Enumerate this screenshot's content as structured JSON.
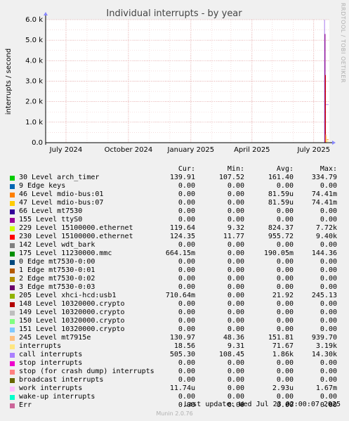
{
  "chart_data": {
    "type": "line",
    "title": "Individual interrupts - by year",
    "ylabel": "interrupts / second",
    "xlabel": "",
    "y_ticks": [
      "0.0",
      "1.0 k",
      "2.0 k",
      "3.0 k",
      "4.0 k",
      "5.0 k",
      "6.0 k"
    ],
    "ylim": [
      0,
      6000
    ],
    "x_ticks": [
      "July 2024",
      "October 2024",
      "January 2025",
      "April 2025",
      "July 2025"
    ],
    "xlim": [
      "2024-06-01",
      "2025-07-24"
    ],
    "grid": true,
    "spike_date": "2025-07-17",
    "series": [
      {
        "name": "call interrupts",
        "color": "#b790f0",
        "values": [
          14300,
          1860
        ]
      },
      {
        "name": "155 Level ttyS0",
        "color": "#8b008b",
        "values": [
          5300,
          0
        ]
      },
      {
        "name": "230 Level 15100000.ethernet",
        "color": "#cc0000",
        "values": [
          3300,
          0
        ]
      },
      {
        "name": "245 Level mt7915e",
        "color": "#ff9955",
        "values": [
          400,
          150
        ]
      },
      {
        "name": "interrupts",
        "color": "#ffd966",
        "values": [
          300,
          72
        ]
      }
    ]
  },
  "legend": {
    "headers": {
      "cur": "Cur:",
      "min": "Min:",
      "avg": "Avg:",
      "max": "Max:"
    },
    "rows": [
      {
        "color": "#00cc00",
        "name": "30 Level arch_timer",
        "cur": "139.91",
        "min": "107.52",
        "avg": "161.40",
        "max": "334.79"
      },
      {
        "color": "#0066b3",
        "name": "9 Edge keys",
        "cur": "0.00",
        "min": "0.00",
        "avg": "0.00",
        "max": "0.00"
      },
      {
        "color": "#ff8000",
        "name": "46 Level mdio-bus:01",
        "cur": "0.00",
        "min": "0.00",
        "avg": "81.59u",
        "max": "74.41m"
      },
      {
        "color": "#ffcc00",
        "name": "47 Level mdio-bus:07",
        "cur": "0.00",
        "min": "0.00",
        "avg": "81.59u",
        "max": "74.41m"
      },
      {
        "color": "#330099",
        "name": "66 Level mt7530",
        "cur": "0.00",
        "min": "0.00",
        "avg": "0.00",
        "max": "0.00"
      },
      {
        "color": "#990099",
        "name": "155 Level ttyS0",
        "cur": "0.00",
        "min": "0.00",
        "avg": "0.00",
        "max": "0.00"
      },
      {
        "color": "#ccff00",
        "name": "229 Level 15100000.ethernet",
        "cur": "119.64",
        "min": "9.32",
        "avg": "824.37",
        "max": "7.72k"
      },
      {
        "color": "#ff0000",
        "name": "230 Level 15100000.ethernet",
        "cur": "124.35",
        "min": "11.77",
        "avg": "955.72",
        "max": "9.40k"
      },
      {
        "color": "#808080",
        "name": "142 Level wdt_bark",
        "cur": "0.00",
        "min": "0.00",
        "avg": "0.00",
        "max": "0.00"
      },
      {
        "color": "#008f00",
        "name": "175 Level 11230000.mmc",
        "cur": "664.15m",
        "min": "0.00",
        "avg": "190.05m",
        "max": "144.36"
      },
      {
        "color": "#00487d",
        "name": "0 Edge mt7530-0:00",
        "cur": "0.00",
        "min": "0.00",
        "avg": "0.00",
        "max": "0.00"
      },
      {
        "color": "#b35a00",
        "name": "1 Edge mt7530-0:01",
        "cur": "0.00",
        "min": "0.00",
        "avg": "0.00",
        "max": "0.00"
      },
      {
        "color": "#b38f00",
        "name": "2 Edge mt7530-0:02",
        "cur": "0.00",
        "min": "0.00",
        "avg": "0.00",
        "max": "0.00"
      },
      {
        "color": "#6b006b",
        "name": "3 Edge mt7530-0:03",
        "cur": "0.00",
        "min": "0.00",
        "avg": "0.00",
        "max": "0.00"
      },
      {
        "color": "#8fb300",
        "name": "205 Level xhci-hcd:usb1",
        "cur": "710.64m",
        "min": "0.00",
        "avg": "21.92",
        "max": "245.13"
      },
      {
        "color": "#b30000",
        "name": "148 Level 10320000.crypto",
        "cur": "0.00",
        "min": "0.00",
        "avg": "0.00",
        "max": "0.00"
      },
      {
        "color": "#bebebe",
        "name": "149 Level 10320000.crypto",
        "cur": "0.00",
        "min": "0.00",
        "avg": "0.00",
        "max": "0.00"
      },
      {
        "color": "#80ff80",
        "name": "150 Level 10320000.crypto",
        "cur": "0.00",
        "min": "0.00",
        "avg": "0.00",
        "max": "0.00"
      },
      {
        "color": "#80c9ff",
        "name": "151 Level 10320000.crypto",
        "cur": "0.00",
        "min": "0.00",
        "avg": "0.00",
        "max": "0.00"
      },
      {
        "color": "#ffc080",
        "name": "245 Level mt7915e",
        "cur": "130.97",
        "min": "48.36",
        "avg": "151.81",
        "max": "939.70"
      },
      {
        "color": "#ffe680",
        "name": "interrupts",
        "cur": "18.56",
        "min": "9.31",
        "avg": "71.67",
        "max": "3.19k"
      },
      {
        "color": "#aa80ff",
        "name": "call interrupts",
        "cur": "505.30",
        "min": "108.45",
        "avg": "1.86k",
        "max": "14.30k"
      },
      {
        "color": "#ee00cc",
        "name": "stop interrupts",
        "cur": "0.00",
        "min": "0.00",
        "avg": "0.00",
        "max": "0.00"
      },
      {
        "color": "#ff8080",
        "name": "stop (for crash dump) interrupts",
        "cur": "0.00",
        "min": "0.00",
        "avg": "0.00",
        "max": "0.00"
      },
      {
        "color": "#666600",
        "name": "broadcast interrupts",
        "cur": "0.00",
        "min": "0.00",
        "avg": "0.00",
        "max": "0.00"
      },
      {
        "color": "#ffbfff",
        "name": "work interrupts",
        "cur": "11.74u",
        "min": "0.00",
        "avg": "2.93u",
        "max": "1.67m"
      },
      {
        "color": "#00ffcc",
        "name": "wake-up interrupts",
        "cur": "0.00",
        "min": "0.00",
        "avg": "0.00",
        "max": "0.00"
      },
      {
        "color": "#cc6699",
        "name": "Err",
        "cur": "0.00",
        "min": "0.00",
        "avg": "0.00",
        "max": "0.00"
      }
    ]
  },
  "last_update": "Last update:  Wed Jul 23 02:00:07 2025",
  "footer": "Munin 2.0.76",
  "watermark": "RRDTOOL / TOBI OETIKER"
}
